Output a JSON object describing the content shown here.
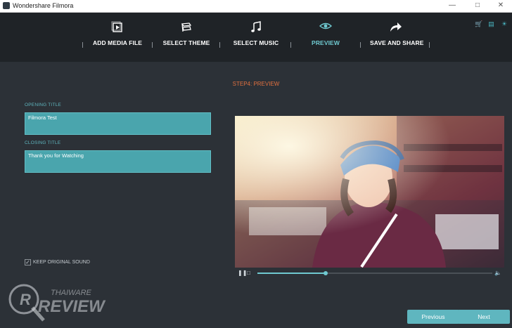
{
  "window": {
    "title": "Wondershare Filmora"
  },
  "steps": [
    {
      "label": "ADD MEDIA FILE",
      "icon": "media-file-icon"
    },
    {
      "label": "SELECT THEME",
      "icon": "theme-icon"
    },
    {
      "label": "SELECT MUSIC",
      "icon": "music-note-icon"
    },
    {
      "label": "PREVIEW",
      "icon": "eye-icon",
      "active": true
    },
    {
      "label": "SAVE AND SHARE",
      "icon": "share-arrow-icon"
    }
  ],
  "page": {
    "heading": "STEP4: PREVIEW"
  },
  "opening": {
    "label": "OPENING TITLE",
    "value": "Filmora Test"
  },
  "closing": {
    "label": "CLOSING TITLE",
    "value": "Thank you for Watching"
  },
  "sound": {
    "label": "KEEP ORIGINAL SOUND",
    "checked": true
  },
  "player": {
    "progress": 0.29
  },
  "buttons": {
    "previous": "Previous",
    "next": "Next"
  },
  "watermark": {
    "text_top": "THAIWARE",
    "text_bottom": "REVIEW"
  },
  "colors": {
    "accent": "#5fb6bf",
    "heading": "#e0703f",
    "background": "#2c3137",
    "stepbar": "#1f2327"
  }
}
